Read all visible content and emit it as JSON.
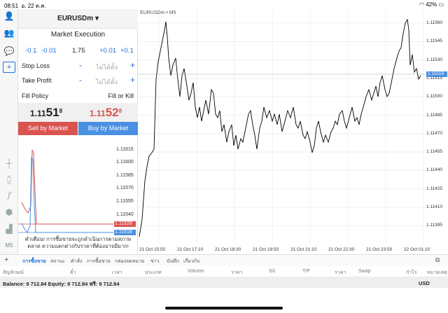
{
  "status": {
    "time": "08:51",
    "date": "อ. 22 ต.ค.",
    "battery": "42%"
  },
  "toolbar": {
    "items": [
      "user-icon",
      "users-icon",
      "chat-icon",
      "new-order-icon"
    ]
  },
  "chart_tools": [
    "crosshair-icon",
    "indicators-icon",
    "function-icon",
    "objects-icon",
    "shapes-icon",
    "timeframe-icon"
  ],
  "timeframe_label": "M5",
  "order": {
    "symbol": "EURUSDm",
    "dropdown_glyph": "▾",
    "execution": "Market Execution",
    "lot_minus": [
      "-0.1",
      "-0.01"
    ],
    "lot_value": "1.75",
    "lot_plus": [
      "+0.01",
      "+0.1"
    ],
    "stop_loss_label": "Stop Loss",
    "take_profit_label": "Take Profit",
    "minus_sign": "-",
    "plus_sign": "+",
    "placeholder": "ไม่ได้ตั้ง",
    "fill_policy_label": "Fill Policy",
    "fill_policy_value": "Fill or Kill",
    "bid": {
      "prefix": "1.11",
      "big": "51",
      "sup": "8"
    },
    "ask": {
      "prefix": "1.11",
      "big": "52",
      "sup": "8"
    },
    "sell_label": "Sell by Market",
    "buy_label": "Buy by Market",
    "warning": "คำเตือน! การซื้อขายจะถูกดำเนินการตามสภาพตลาด ความแตกต่างกับราคาที่ต้องอาจมีมาก!"
  },
  "mini_chart": {
    "ticks": [
      "1.11615",
      "1.11600",
      "1.11585",
      "1.11570",
      "1.11555",
      "1.11540"
    ],
    "ask_label": "1.11528",
    "bid_label": "1.11518",
    "ask_color": "#d9534f",
    "bid_color": "#4a90e2"
  },
  "chart": {
    "symbol": "EURUSDm",
    "timeframe": "M5",
    "yticks": [
      "1.11560",
      "1.11545",
      "1.11530",
      "1.11515",
      "1.11500",
      "1.11485",
      "1.11470",
      "1.11455",
      "1.11440",
      "1.11425",
      "1.11410",
      "1.11395"
    ],
    "xticks": [
      "21 Oct 15:50",
      "21 Oct 17:10",
      "21 Oct 18:30",
      "21 Oct 19:50",
      "21 Oct 21:10",
      "21 Oct 22:30",
      "21 Oct 23:50",
      "22 Oct 01:10"
    ],
    "current_price": "1.11518",
    "line_color": "#000000",
    "grid_color": "#e6e6e6"
  },
  "tabs": [
    "การซื้อขาย",
    "สถานะ",
    "คำสั่ง",
    "การซื้อขาย",
    "กล่องจดหมาย",
    "ข่าว",
    "บันทึก",
    "เกี่ยวกับ"
  ],
  "columns": [
    "สัญลักษณ์",
    "ตั๋ว",
    "เวลา",
    "ประเภท",
    "Volume",
    "ราคา",
    "S/L",
    "T/P",
    "ราคา",
    "Swap",
    "กำไร",
    "หมายเหตุ"
  ],
  "balance": {
    "text": "Balance: 9 712.84 Equity: 9 712.84 ฟรี: 9 712.84",
    "currency": "USD"
  }
}
